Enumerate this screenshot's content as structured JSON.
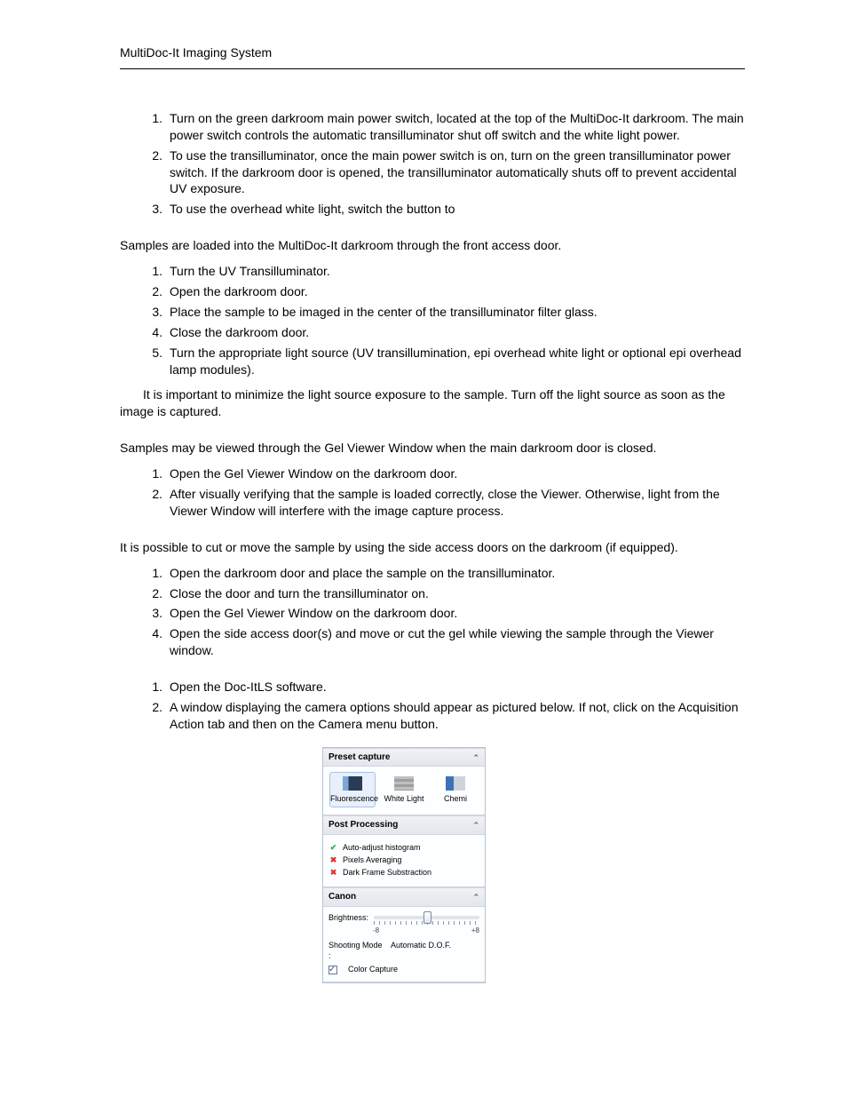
{
  "header": {
    "left": "MultiDoc-It Imaging System",
    "right_line1": "",
    "right_line2": ""
  },
  "section": {
    "using": {
      "heading": ""
    },
    "power": {
      "heading": "",
      "items": [
        "Turn on the green darkroom main power switch, located at the top of the MultiDoc-It darkroom. The main power switch controls the automatic transilluminator shut off switch and the white light power.",
        "To use the transilluminator, once the main power switch is on, turn on the green transilluminator power switch. If the darkroom door is opened, the transilluminator automatically shuts off to prevent accidental UV exposure."
      ],
      "item3_a": "To use the overhead white light, switch the ",
      "item3_bold": "",
      "item3_b": " button to ",
      "item3_bold2": ""
    },
    "loading": {
      "heading": "",
      "intro": "Samples are loaded into the MultiDoc-It darkroom through the front access door.",
      "items": [
        {
          "a": "Turn ",
          "bold": "",
          "b": " the UV Transilluminator."
        },
        {
          "a": "Open the darkroom door.",
          "bold": "",
          "b": ""
        },
        {
          "a": "Place the sample to be imaged in the center of the transilluminator filter glass.",
          "bold": "",
          "b": ""
        },
        {
          "a": "Close the darkroom door.",
          "bold": "",
          "b": ""
        },
        {
          "a": "Turn ",
          "bold": "",
          "b": " the appropriate light source (UV transillumination, epi overhead white light or optional epi overhead lamp modules)."
        }
      ],
      "note_label": "",
      "note_text": " It is important to minimize the light source exposure to the sample. Turn off the light source as soon as the image is captured."
    },
    "gelviewer": {
      "heading": "",
      "intro": "Samples may be viewed through the Gel Viewer Window when the main darkroom door is closed.",
      "items": [
        "Open the Gel Viewer Window on the darkroom door.",
        "After visually verifying that the sample is loaded correctly, close the Viewer. Otherwise, light from the Viewer Window will interfere with the image capture process."
      ]
    },
    "side": {
      "heading": "",
      "intro": "It is possible to cut or move the sample by using the side access doors on the darkroom (if equipped).",
      "items": [
        "Open the darkroom door and place the sample on the transilluminator.",
        "Close the door and turn the transilluminator on.",
        "Open the Gel Viewer Window on the darkroom door.",
        "Open the side access door(s) and move or cut the gel while viewing the sample through the Viewer window."
      ]
    },
    "capture": {
      "heading": "",
      "items": [
        "Open the Doc-ItLS software.",
        "A window displaying the camera options should appear as pictured below. If not, click on the Acquisition Action tab and then on the Camera menu button."
      ]
    }
  },
  "panel": {
    "preset_head": "Preset capture",
    "buttons": {
      "fluor": "Fluorescence",
      "white": "White Light",
      "chemi": "Chemi"
    },
    "post_head": "Post Processing",
    "post_items": [
      "Auto-adjust histogram",
      "Pixels Averaging",
      "Dark Frame Substraction"
    ],
    "canon_head": "Canon",
    "brightness_label": "Brightness:",
    "minus": "-8",
    "plus": "+8",
    "shoot_k": "Shooting Mode :",
    "shoot_v": "Automatic D.O.F.",
    "colorcap": "Color Capture"
  }
}
